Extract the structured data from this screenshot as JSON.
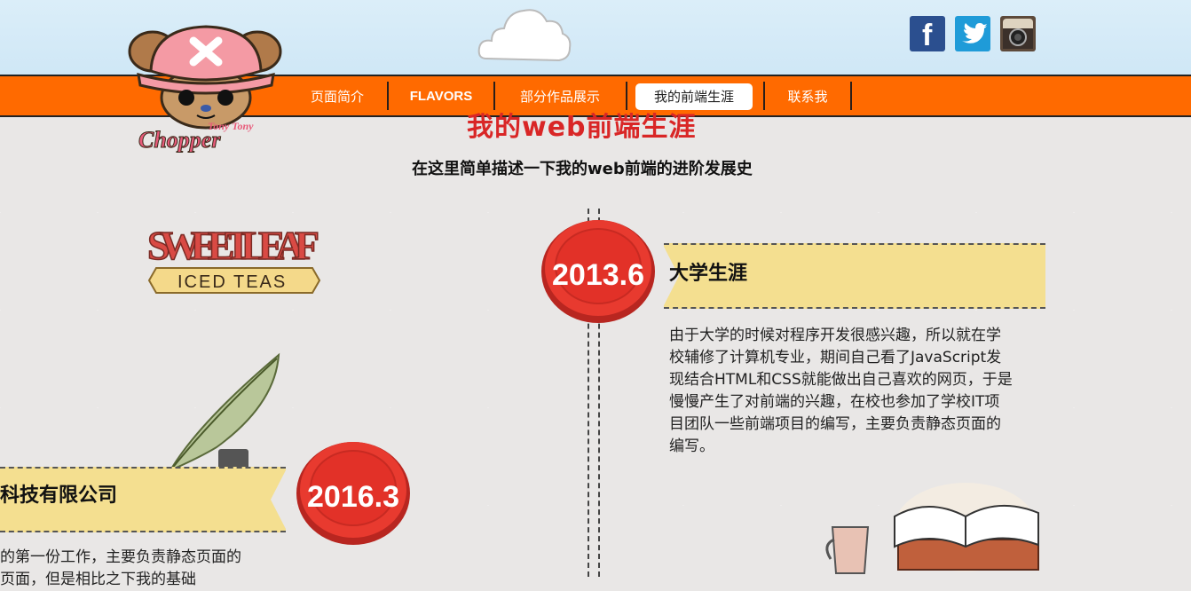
{
  "nav": {
    "items": [
      "页面简介",
      "FLAVORS",
      "部分作品展示",
      "我的前端生涯",
      "联系我"
    ],
    "active_index": 3
  },
  "logo": {
    "text_line1": "Tony Tony",
    "text_line2": "Chopper"
  },
  "social": [
    "facebook-icon",
    "twitter-icon",
    "instagram-icon"
  ],
  "section": {
    "title": "我的web前端生涯",
    "subtitle": "在这里简单描述一下我的web前端的进阶发展史"
  },
  "brand": {
    "line1": "SWEET LEAF",
    "line2": "ICED TEAS"
  },
  "timeline": [
    {
      "date": "2013.6",
      "heading": "大学生涯",
      "body_lines": [
        "由于大学的时候对程序开发很感兴趣，所以就在学",
        "校辅修了计算机专业，期间自己看了JavaScript发",
        "现结合HTML和CSS就能做出自己喜欢的网页，于是",
        "慢慢产生了对前端的兴趣，在校也参加了学校IT项",
        "目团队一些前端项目的编写，主要负责静态页面的",
        "编写。"
      ]
    },
    {
      "date": "2016.3",
      "heading": "科技有限公司",
      "body_lines": [
        "的第一份工作，主要负责静态页面的",
        "页面，但是相比之下我的基础"
      ]
    }
  ],
  "colors": {
    "nav": "#ff6a00",
    "accent_red": "#e83a2f",
    "ribbon": "#f4df90"
  }
}
